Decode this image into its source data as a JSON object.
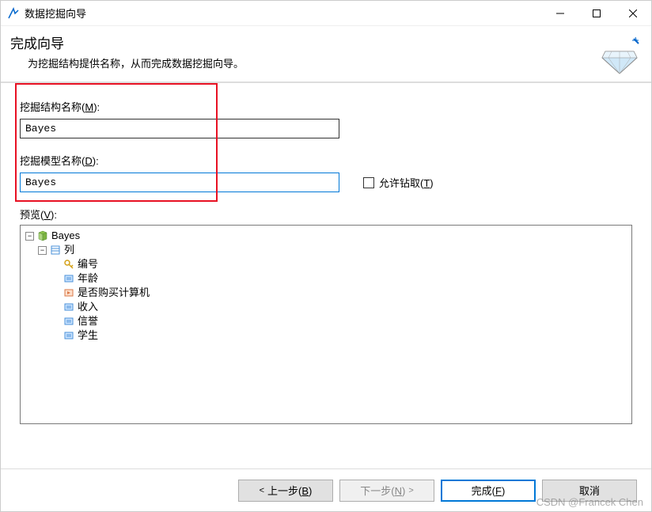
{
  "titlebar": {
    "title": "数据挖掘向导"
  },
  "header": {
    "title": "完成向导",
    "subtitle": "为挖掘结构提供名称，从而完成数据挖掘向导。"
  },
  "fields": {
    "structure_label_prefix": "挖掘结构名称(",
    "structure_label_key": "M",
    "structure_label_suffix": "):",
    "structure_value": "Bayes",
    "model_label_prefix": "挖掘模型名称(",
    "model_label_key": "D",
    "model_label_suffix": "):",
    "model_value": "Bayes",
    "allow_drill_prefix": "允许钻取(",
    "allow_drill_key": "T",
    "allow_drill_suffix": ")"
  },
  "preview": {
    "label_prefix": "预览(",
    "label_key": "V",
    "label_suffix": "):",
    "root": "Bayes",
    "columns_label": "列",
    "items": [
      {
        "name": "编号",
        "kind": "key"
      },
      {
        "name": "年龄",
        "kind": "input"
      },
      {
        "name": "是否购买计算机",
        "kind": "predict"
      },
      {
        "name": "收入",
        "kind": "input"
      },
      {
        "name": "信誉",
        "kind": "input"
      },
      {
        "name": "学生",
        "kind": "input"
      }
    ]
  },
  "footer": {
    "back_prefix": "上一步(",
    "back_key": "B",
    "back_suffix": ")",
    "next_prefix": "下一步(",
    "next_key": "N",
    "next_suffix": ")",
    "finish_prefix": "完成(",
    "finish_key": "F",
    "finish_suffix": ")",
    "cancel": "取消"
  },
  "watermark": "CSDN @Francek Chen"
}
